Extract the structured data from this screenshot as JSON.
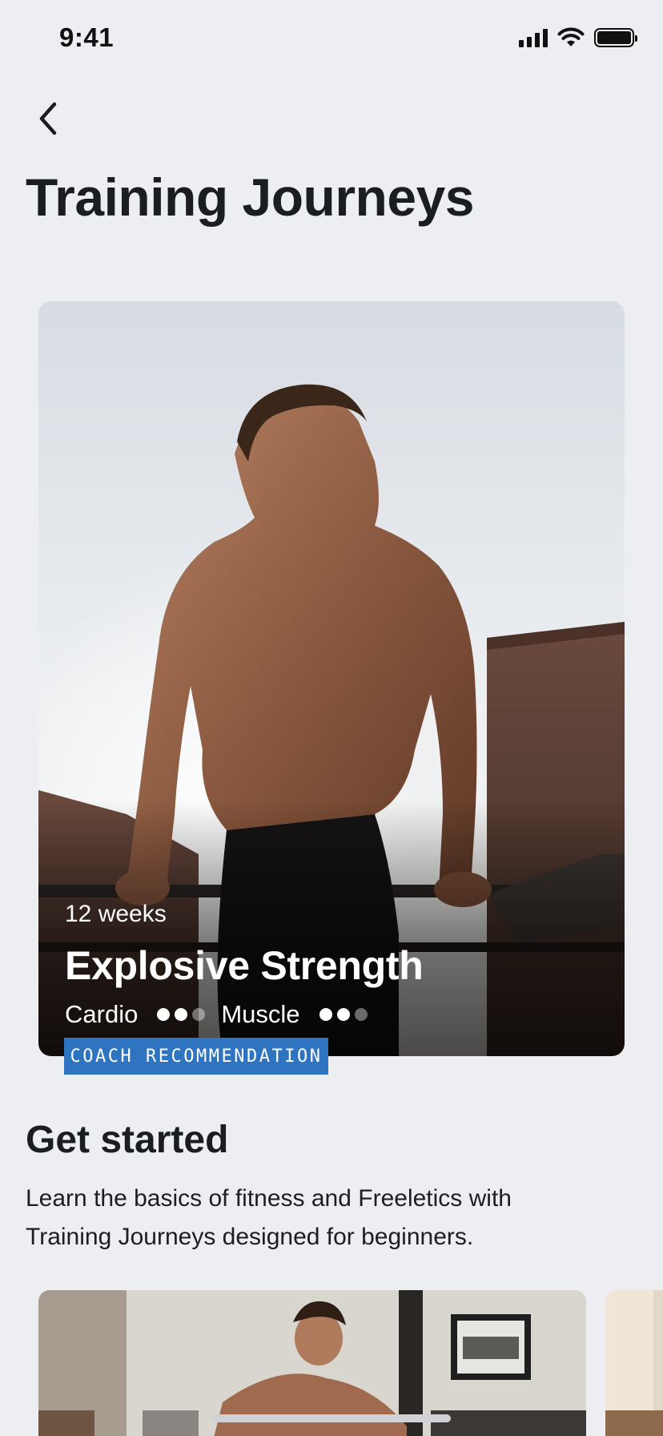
{
  "status_bar": {
    "time": "9:41",
    "icons": [
      "signal-icon",
      "wifi-icon",
      "battery-icon"
    ]
  },
  "header": {
    "back_icon": "chevron-left-icon",
    "title": "Training Journeys"
  },
  "featured": {
    "duration": "12 weeks",
    "title": "Explosive Strength",
    "metrics": [
      {
        "label": "Cardio",
        "level": 2,
        "max": 3
      },
      {
        "label": "Muscle",
        "level": 2,
        "max": 3
      }
    ],
    "badge": "COACH RECOMMENDATION",
    "badge_color": "#2f74c0"
  },
  "get_started": {
    "title": "Get started",
    "description": "Learn the basics of fitness and Freeletics with Training Journeys designed for beginners."
  },
  "colors": {
    "background": "#eceef1",
    "text": "#1a1d21"
  }
}
